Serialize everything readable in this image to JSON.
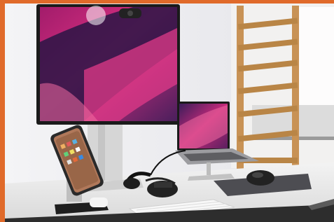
{
  "scene": {
    "description_icons": [
      "monitor-icon",
      "laptop-icon",
      "phone-icon",
      "keyboard-icon",
      "mouse-icon",
      "ladder-icon",
      "headphones-icon"
    ],
    "colors": {
      "accent_orange": "#e06a2a",
      "frame_dark": "#2d2d2d",
      "wall": "#eeeef0",
      "desk": "#ececec",
      "wallpaper_magenta": "#c2287a",
      "wallpaper_purple": "#3b1c55",
      "wood": "#c89255"
    }
  }
}
